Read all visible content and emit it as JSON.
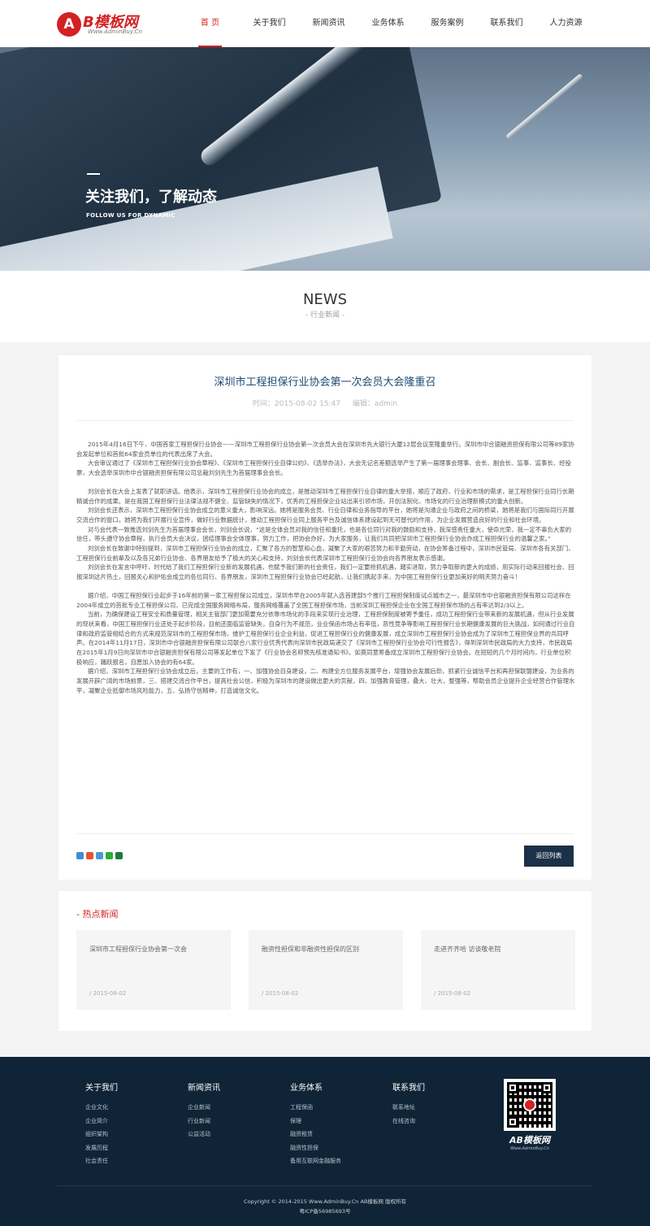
{
  "header": {
    "logo_mark": "A",
    "logo_text": "B模板网",
    "logo_sub": "Www.AdminBuy.Cn",
    "nav": [
      {
        "label": "首 页"
      },
      {
        "label": "关于我们"
      },
      {
        "label": "新闻资讯"
      },
      {
        "label": "业务体系"
      },
      {
        "label": "服务案例"
      },
      {
        "label": "联系我们"
      },
      {
        "label": "人力资源"
      }
    ],
    "active_index": 0
  },
  "banner": {
    "title": "关注我们，了解动态",
    "subtitle": "FOLLOW US FOR DYNAMIC"
  },
  "section": {
    "title": "NEWS",
    "subtitle": "- 行业新闻 -"
  },
  "article": {
    "title": "深圳市工程担保行业协会第一次会员大会隆重召",
    "date_label": "时间：2015-08-02 15:47",
    "author_label": "编辑：admin",
    "paragraphs": [
      "2015年4月16日下午，中国首家工程担保行业协会——深圳市工程担保行业协会第一次会员大会在深圳市先大银行大厦12层会议室隆重举行。深圳市中合银融资担保有限公司等89家协会发起单位和首批64家会员单位的代表出席了大会。",
      "大会审议通过了《深圳市工程担保行业协会章程》、《深圳市工程担保行业自律公约》、《选举办法》，大会无记名差额选举产生了第一届理事会理事、会长、副会长、监事、监事长、经投票，大会选举深圳市中合银融资担保有限公司总裁刘剑先生为首届理事会会长。",
      "刘剑会长在大会上发表了就职讲话。他表示，深圳市工程担保行业协会的成立，是推动深圳市工程担保行业自律的重大举措，顺应了政府、行业和市场的需求，是工程担保行业同行长期精诚合作的成果。是在我国工程担保行业法律法规不健全、监管缺失的情况下，优秀的工程担保企业站出来引领市场，开创法制化、市场化的行业治理新模式的重大创新。",
      "刘剑会长还表示，深圳市工程担保行业协会成立的意义重大，影响深远。她将是服务会员、行业自律和业务指导的平台，她将是沟通企业与政府之间的桥梁，她将是我们与国际同行开展交流合作的窗口，她将为我们开展行业宣传，做好行业数据统计，推动工程担保行业同上服务平台及诚信体系建设起到无可替代的作用，为企业发展营造良好的行业和社会环境。",
      "对与会代表一致推选刘剑先生为首届理事会会长，刘剑会长说，“这是全体会员对我的信任和重托，也是各位同行对我的鼓励和支持，我深感责任重大，使命光荣，我一定不辜负大家的信任，带头遵守协会章程，执行会员大会决议，团结理事会全体理事，努力工作，把协会办好，为大家服务，让我们共同把深圳市工程担保行业协会办成工程担保行业的温馨之家。”",
      "刘剑会长在致谢中特别提到，深圳市工程担保行业协会的成立，汇聚了各方的智慧和心血，凝聚了大家的艰苦努力和辛勤劳动，在协会筹备过程中，深圳市民管局、深圳市各有关部门、工程担保行业前辈及以及各兄弟行业协会、各界朋友给予了极大的关心和支持，刘剑会长代表深圳市工程担保行业协会向各界朋友表示感谢。",
      "刘剑会长在发言中呼吁，时代给了我们工程担保行业新的发展机遇，也赋予我们新的社会责任，我们一定要抢抓机遇，踏实进取，努力争取新的更大的成绩，用实际行动来回报社会、回报深圳这片热土，回报关心和护佑会成立的各位同行、各界朋友，深圳市工程担保行业协会已经起航，让我们携起手来，为中国工程担保行业更加美好的明天努力奋斗！",
      "据介绍，中国工程担保行业起步于16年前的第一家工程担保公司成立，深圳市早在2005年就入选首建部5个推行工程担保制度试点城市之一，最深圳市中合银融资担保有限公司这样在2004年成立的首批专业工程担保公司，已完成全国服务网络布局，服务网络覆盖了全国工程担保市场，当前深圳工程担保企业在全国工程担保市场的占有率达到2/3以上。",
      "当前，为确保建设工程安全和质量管理，相关主管部门更加需要充分依靠市场化的手段来实现行业治理，工程担保制度被寄予重任，成功工程担保行业带来新的发展机遇，但从行业发展的现状来看，中国工程担保行业还处于起步阶段，目前还面临监管缺失，自身行为不规范，业业保函市场占有率低，恶性竞争等影响工程担保行业长期健康发展的巨大挑战，如何通过行业自律和政府监管相结合的方式来规范深圳市的工程担保市场，维护工程担保行业企业利益，促进工程担保行业的健康发展，成立深圳市工程担保行业协会成为了深圳市工程担保业界的共同呼声。在2014年11月17日，深圳市中合银融资担保有限公司联合八家行业优秀代表向深圳市民政局递交了《深圳市工程担保行业协会可行性报告》，得到深圳市民政局的大力支持，市民政局在2015年1月9日向深圳市中合银融资担保有限公司等发起单位下发了《行业协会名称预先核准通知书》，如莫同意筹备成立深圳市工程担保行业协会。在短短的几个月时间内，行业单位积极响应，踊跃报名，自愿加入协会的有64家。",
      "据介绍，深圳市工程担保行业协会成立后，主要的工作有，一、加强协会自身建设，二、构建全方位服务发展平台，增强协会发展后劲，抓紧行业诚信平台和再担保联盟建设，为业务的发展开辟广阔的市场前景，三、搭建交流合作平台，提高社会公信，积极为深圳市的建设做出更大的贡献，四、加强教育管理，叠大、壮大，整强等，帮助会员企业提升企业经营合作管理水平，凝聚企业抵御市场风险能力，五、弘扬守信精神，打造诚信文化。"
    ],
    "back_label": "返回列表",
    "share_icons": [
      "qzone-icon",
      "weibo-icon",
      "tencent-weibo-icon",
      "wechat-icon",
      "renren-icon"
    ]
  },
  "hot": {
    "title": "- 热点新闻",
    "items": [
      {
        "title": "深圳市工程担保行业协会第一次会",
        "date": "/ 2015-08-02"
      },
      {
        "title": "融资性担保和非融资性担保的区别",
        "date": "/ 2015-08-02"
      },
      {
        "title": "走进齐齐哈 访谈敬老院",
        "date": "/ 2015-08-02"
      }
    ]
  },
  "footer": {
    "columns": [
      {
        "title": "关于我们",
        "links": [
          "企业文化",
          "企业简介",
          "组织架构",
          "发展历程",
          "社会责任"
        ]
      },
      {
        "title": "新闻资讯",
        "links": [
          "企业新闻",
          "行业新闻",
          "公益活动"
        ]
      },
      {
        "title": "业务体系",
        "links": [
          "工程保函",
          "保理",
          "融资租赁",
          "融资性担保",
          "备用互联网金融服务"
        ]
      },
      {
        "title": "联系我们",
        "links": [
          "联系地址",
          "在线咨询"
        ]
      }
    ],
    "qr_logo": "AB模板网",
    "qr_logo_sub": "Www.AdminBuy.Cn",
    "copyright": "Copyright © 2014-2015 Www.AdminBuy.Cn AB模板网 版权所有",
    "icp": "粤ICP备56985693号"
  },
  "colors": {
    "brand_red": "#d32124",
    "footer_bg": "#0f2436",
    "title_blue": "#1d4a73",
    "button_bg": "#1b3147"
  }
}
